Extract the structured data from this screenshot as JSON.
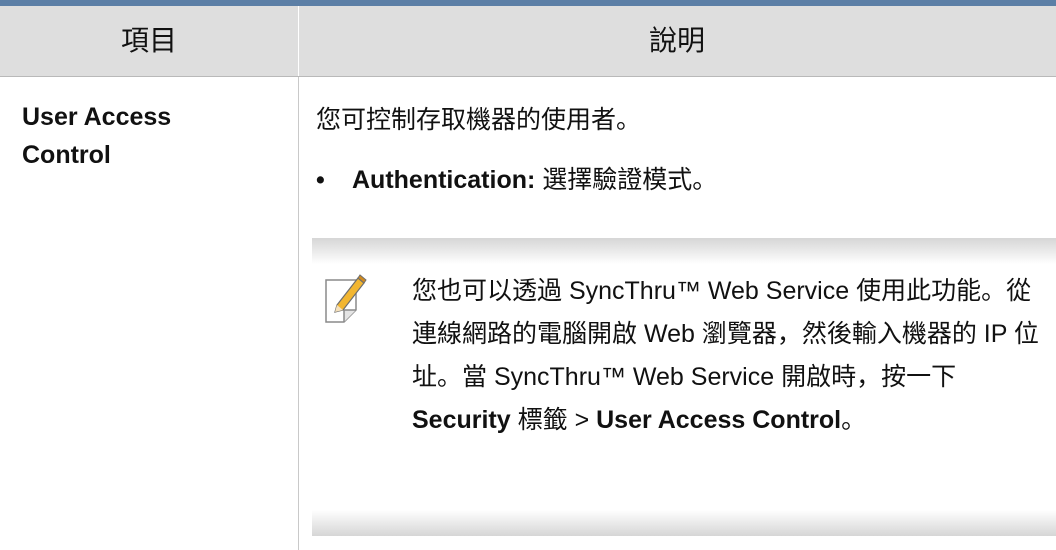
{
  "table": {
    "header": {
      "item": "項目",
      "description": "說明"
    },
    "row": {
      "item_line1": "User Access",
      "item_line2": "Control",
      "description": "您可控制存取機器的使用者。",
      "bullet": {
        "term": "Authentication:",
        "text": " 選擇驗證模式。"
      },
      "note": {
        "icon": "note-pencil-icon",
        "text_1": "您也可以透過 SyncThru™ Web Service 使用此功能。從連線網路的電腦開啟 Web 瀏覽器，然後輸入機器的 IP 位址。當 SyncThru™ Web Service 開啟時，按一下 ",
        "bold_1": "Security",
        "text_2": " 標籤 > ",
        "bold_2": "User Access Control",
        "text_3": "。"
      }
    }
  },
  "colors": {
    "top_rule": "#5c7fa6",
    "header_bg": "#dedede",
    "note_shade": "#d6d6d6",
    "icon_accent": "#f2b631"
  }
}
